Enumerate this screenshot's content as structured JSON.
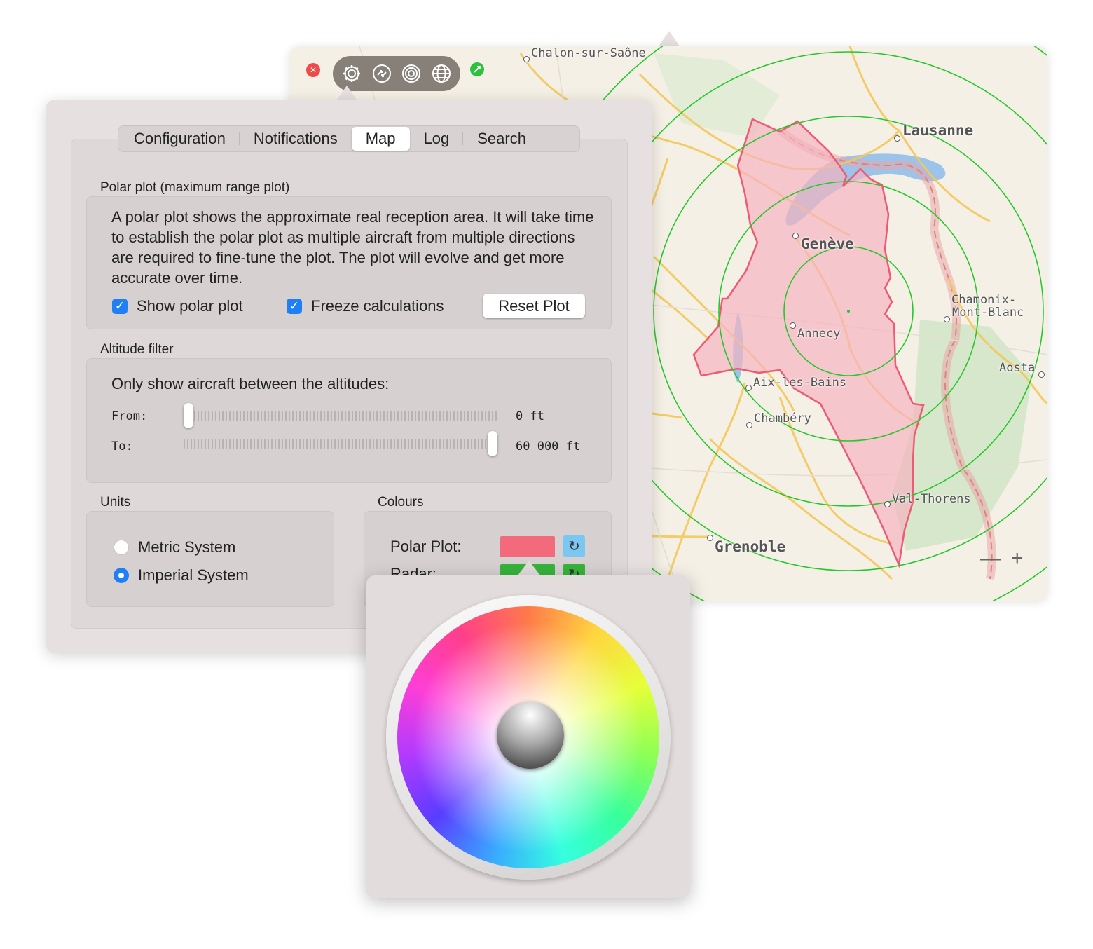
{
  "map": {
    "cities": [
      {
        "name": "Chalon-sur-Saône"
      },
      {
        "name": "Lausanne"
      },
      {
        "name": "Genève"
      },
      {
        "name": "Chamonix-"
      },
      {
        "name": "Mont-Blanc"
      },
      {
        "name": "Annecy"
      },
      {
        "name": "Aosta"
      },
      {
        "name": "Aix-les-Bains"
      },
      {
        "name": "Chambéry"
      },
      {
        "name": "Val-Thorens"
      },
      {
        "name": "Grenoble"
      }
    ],
    "zoom_out_label": "—",
    "zoom_in_label": "+",
    "ring_color": "#24c82a",
    "polygon_color": "#f06a7e"
  },
  "toolbar": {
    "icons": [
      "gear-icon",
      "arrows-icon",
      "target-icon",
      "globe-icon"
    ],
    "close_glyph": "✕"
  },
  "settings": {
    "tabs": [
      {
        "label": "Configuration"
      },
      {
        "label": "Notifications"
      },
      {
        "label": "Map",
        "active": true
      },
      {
        "label": "Log"
      },
      {
        "label": "Search"
      }
    ],
    "polar": {
      "section_title": "Polar plot (maximum range plot)",
      "description": "A polar plot shows the approximate real reception area. It will take time to establish the polar plot as multiple aircraft from multiple directions are required to fine-tune the plot. The plot will evolve and get more accurate over time.",
      "show_polar_plot_label": "Show polar plot",
      "show_polar_plot_checked": true,
      "freeze_calculations_label": "Freeze calculations",
      "freeze_calculations_checked": true,
      "reset_button_label": "Reset Plot"
    },
    "altitude": {
      "section_title": "Altitude filter",
      "instruction": "Only show aircraft between the altitudes:",
      "from_label": "From:",
      "from_value": "0 ft",
      "from_fraction": 0.0,
      "to_label": "To:",
      "to_value": "60 000 ft",
      "to_fraction": 1.0
    },
    "units": {
      "section_title": "Units",
      "options": [
        {
          "label": "Metric System",
          "selected": false
        },
        {
          "label": "Imperial System",
          "selected": true
        }
      ]
    },
    "colours": {
      "section_title": "Colours",
      "polar_plot_label": "Polar Plot:",
      "polar_plot_color": "#f26a7b",
      "radar_label": "Radar:",
      "radar_color": "#36b43b",
      "reset_glyph": "↻",
      "reset_active_color": "#7cc7f2"
    }
  }
}
